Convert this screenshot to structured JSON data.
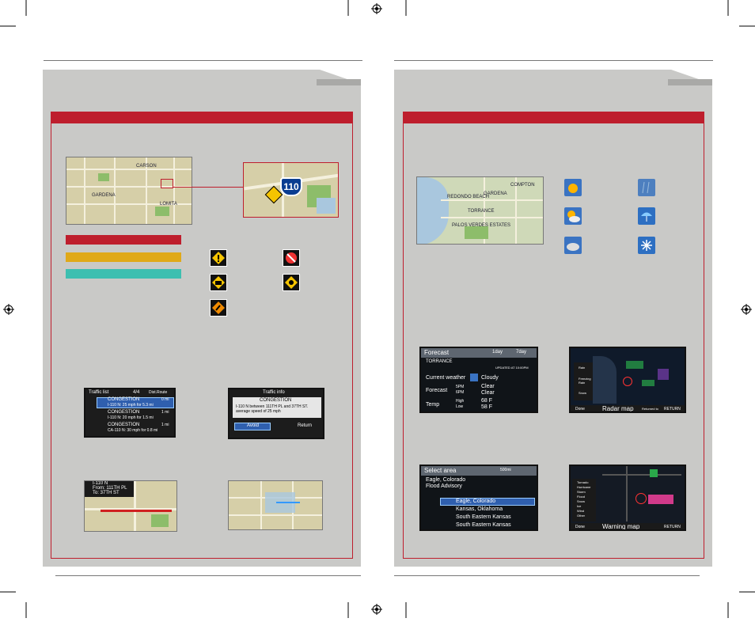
{
  "colors": {
    "accent": "#be1e2d",
    "congestion_red": "#be1e2d",
    "congestion_yellow": "#e0a919",
    "congestion_teal": "#3dbfb0",
    "panel": "#c9c9c7"
  },
  "left": {
    "traffic_list": {
      "title": "Traffic list",
      "count": "4/4",
      "sort": "Dist.Route",
      "rows": [
        {
          "type": "CONGESTION",
          "detail": "I-110 N: 25 mph for 5.3 mi",
          "dist": "0 mi"
        },
        {
          "type": "CONGESTION",
          "detail": "I-110 N: 20 mph for 1.5 mi",
          "dist": "1 mi"
        },
        {
          "type": "CONGESTION",
          "detail": "CA-110 N: 30 mph for 0.8 mi",
          "dist": "1 mi"
        }
      ]
    },
    "traffic_info": {
      "title": "Traffic info",
      "type": "CONGESTION",
      "detail": "I-110 N between 111TH PL and 37TH ST. average speed of 25 mph",
      "avoid": "Avoid",
      "return": "Return"
    },
    "route_popup": {
      "road": "I-110 N",
      "from": "From: 111TH PL",
      "to": "To: 37TH ST"
    },
    "map_labels": [
      "CARSON",
      "GARDENA",
      "LOMITA"
    ],
    "shield": "110"
  },
  "right": {
    "forecast": {
      "title": "Forecast",
      "tab1": "1day",
      "tab2": "7day",
      "city": "TORRANCE",
      "updated": "UPDATED AT 10:00PM",
      "current_label": "Current weather",
      "current_value": "Cloudy",
      "forecast_label": "Forecast",
      "times": [
        "5PM",
        "6PM"
      ],
      "conds": [
        "Clear",
        "Clear"
      ],
      "temp_label": "Temp",
      "high_label": "High",
      "low_label": "Low",
      "high": "68 F",
      "low": "58 F"
    },
    "radar": {
      "title": "Radar map",
      "footer_left": "Done",
      "footer_mid": "Returned to CHART",
      "footer_right": "RETURN",
      "legend": [
        "Rain",
        "Freezing Rain",
        "Snow"
      ]
    },
    "select_area": {
      "title": "Select area",
      "range": "500mi",
      "list_header": "Eagle, Colorado",
      "subheader": "Flood Advisory",
      "items": [
        "Eagle, Colorado",
        "Kansas, Oklahoma",
        "South Eastern Kansas",
        "South Eastern Kansas"
      ]
    },
    "warning": {
      "title": "Warning map",
      "footer_left": "Done",
      "footer_right": "RETURN",
      "legend": [
        "Tornado",
        "Hurricane",
        "Storm",
        "Flood",
        "Snow",
        "Ice",
        "Wind",
        "Other"
      ]
    },
    "map_labels": [
      "TORRANCE",
      "GARDENA",
      "REDONDO BEACH",
      "PALOS VERDES ESTATES",
      "COMPTON"
    ]
  }
}
